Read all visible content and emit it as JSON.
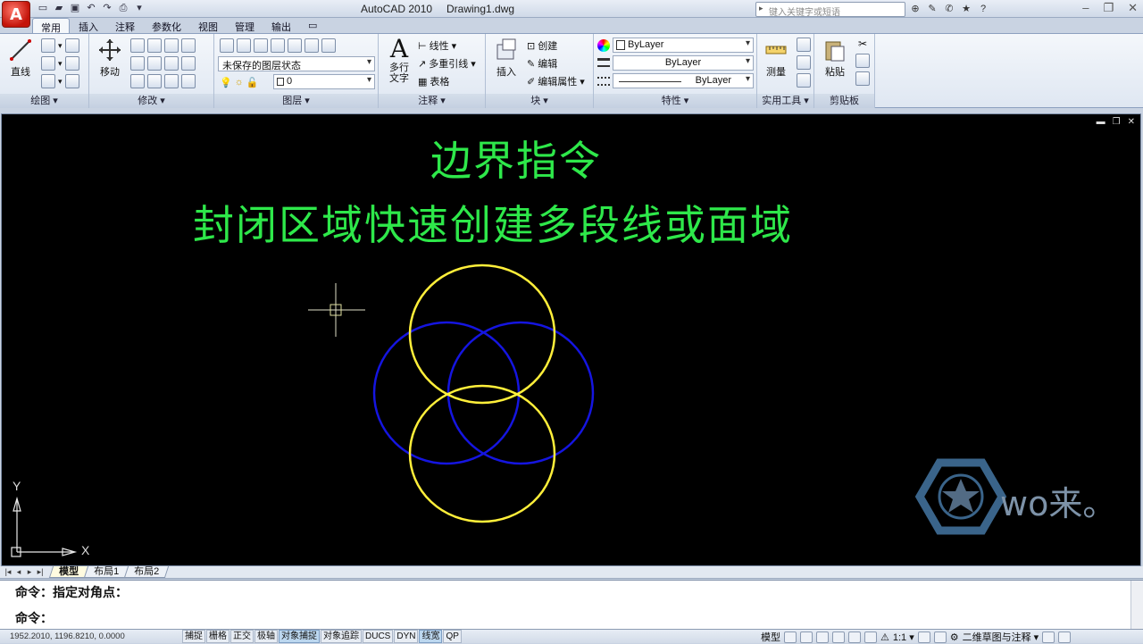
{
  "title_bar": {
    "app_title": "AutoCAD 2010",
    "doc_title": "Drawing1.dwg",
    "search_placeholder": "键入关键字或短语",
    "app_button": "A"
  },
  "ribbon_tabs": [
    "常用",
    "插入",
    "注释",
    "参数化",
    "视图",
    "管理",
    "输出"
  ],
  "panels": {
    "draw": {
      "title": "绘图 ▾",
      "line_label": "直线"
    },
    "modify": {
      "title": "修改 ▾",
      "move_label": "移动"
    },
    "layers": {
      "title": "图层 ▾",
      "layer_state": "未保存的图层状态",
      "layer_current": "0"
    },
    "annotation": {
      "title": "注释 ▾",
      "mtext_label": "多行\n文字",
      "linear_label": "线性 ▾",
      "mleader_label": "多重引线 ▾",
      "table_label": "表格"
    },
    "block": {
      "title": "块 ▾",
      "insert_label": "插入",
      "create_label": "创建",
      "edit_label": "编辑",
      "edit_attr_label": "编辑属性 ▾"
    },
    "properties": {
      "title": "特性 ▾",
      "color": "ByLayer",
      "linetype": "ByLayer",
      "lineweight": "ByLayer"
    },
    "utilities": {
      "title": "实用工具 ▾",
      "measure_label": "测量"
    },
    "clipboard": {
      "title": "剪贴板",
      "paste_label": "粘贴"
    }
  },
  "canvas": {
    "heading_line1": "边界指令",
    "heading_line2": "封闭区域快速创建多段线或面域",
    "watermark_text": "wo来。",
    "axis_x": "X",
    "axis_y": "Y",
    "colors": {
      "background": "#000000",
      "heading": "#2ee84a",
      "yellow_circles": "#ffef3a",
      "blue_circles": "#1515e0"
    }
  },
  "layout_tabs": [
    "模型",
    "布局1",
    "布局2"
  ],
  "command": {
    "line1": "命令：指定对角点：",
    "line2": "命令："
  },
  "status": {
    "coordinates": "1952.2010,  1196.8210,  0.0000",
    "toggles": [
      {
        "label": "捕捉",
        "on": false
      },
      {
        "label": "栅格",
        "on": false
      },
      {
        "label": "正交",
        "on": false
      },
      {
        "label": "极轴",
        "on": false
      },
      {
        "label": "对象捕捉",
        "on": true
      },
      {
        "label": "对象追踪",
        "on": false
      },
      {
        "label": "DUCS",
        "on": false
      },
      {
        "label": "DYN",
        "on": false
      },
      {
        "label": "线宽",
        "on": true
      },
      {
        "label": "QP",
        "on": false
      }
    ],
    "model_label": "模型",
    "scale_label": "1:1 ▾",
    "workspace_label": "二维草图与注释 ▾"
  }
}
